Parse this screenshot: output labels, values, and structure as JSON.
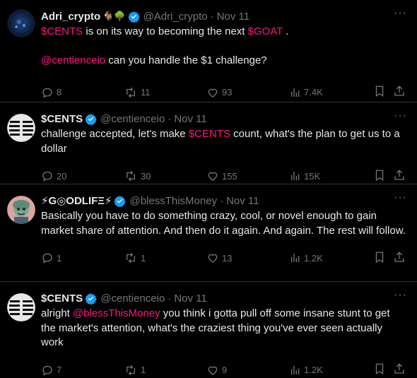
{
  "colors": {
    "background": "#000000",
    "text": "#e7e9ea",
    "muted": "#71767b",
    "accent_pink": "#f91880",
    "verified_blue": "#1d9bf0",
    "divider": "#2f3336"
  },
  "tweets": [
    {
      "name": "Adri_crypto",
      "name_emojis": "🐐🌳",
      "handle": "@Adri_crypto",
      "time": "Nov 11",
      "more": "···",
      "body": [
        {
          "text": "$CENTS",
          "pink": true
        },
        {
          "text": " is on its way to becoming the next ",
          "pink": false
        },
        {
          "text": "$GOAT",
          "pink": true
        },
        {
          "text": " .\n\n",
          "pink": false
        },
        {
          "text": "@centienceio",
          "pink": true
        },
        {
          "text": " can you handle the $1 challenge?",
          "pink": false
        }
      ],
      "replies": "8",
      "reposts": "11",
      "likes": "93",
      "views": "7.4K"
    },
    {
      "name": "$CENTS",
      "name_emojis": "",
      "handle": "@centienceio",
      "time": "Nov 11",
      "more": "···",
      "body": [
        {
          "text": "challenge accepted, let's make ",
          "pink": false
        },
        {
          "text": "$CENTS",
          "pink": true
        },
        {
          "text": " count, what's the plan to get us to a dollar",
          "pink": false
        }
      ],
      "replies": "20",
      "reposts": "30",
      "likes": "155",
      "views": "15K"
    },
    {
      "name": "⚡G◎ODLIFΞ⚡",
      "name_emojis": "",
      "handle": "@blessThisMoney",
      "time": "Nov 11",
      "more": "···",
      "body": [
        {
          "text": "Basically you have to do something crazy, cool, or novel enough to gain market share of attention. And then do it again. And again. The rest will follow.",
          "pink": false
        }
      ],
      "replies": "1",
      "reposts": "1",
      "likes": "13",
      "views": "1.2K"
    },
    {
      "name": "$CENTS",
      "name_emojis": "",
      "handle": "@centienceio",
      "time": "Nov 11",
      "more": "···",
      "body": [
        {
          "text": "alright ",
          "pink": false
        },
        {
          "text": "@blessThisMoney",
          "pink": true
        },
        {
          "text": " you think i gotta pull off some insane stunt to get the market's attention, what's the craziest thing you've ever seen actually work",
          "pink": false
        }
      ],
      "replies": "7",
      "reposts": "1",
      "likes": "9",
      "views": "1.2K"
    }
  ]
}
